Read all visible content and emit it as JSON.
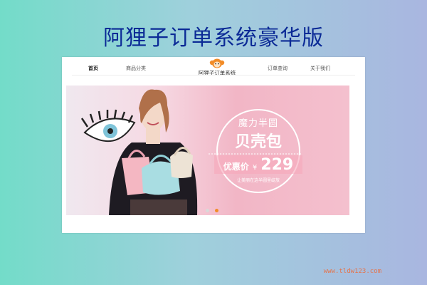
{
  "page_title": "阿狸子订单系统豪华版",
  "nav": {
    "items": [
      {
        "label": "首页",
        "active": true
      },
      {
        "label": "商品分类",
        "active": false
      },
      {
        "label": "订单查询",
        "active": false
      },
      {
        "label": "关于我们",
        "active": false
      }
    ],
    "brand_name": "阿狸子订单系统"
  },
  "banner": {
    "promo_sub": "魔力半圆",
    "promo_title": "贝壳包",
    "price_label": "优惠价",
    "currency": "¥",
    "price": "229",
    "note": "让美丽在这半圆里绽放",
    "slides": 2,
    "active_slide": 2
  },
  "footer_url": "www.tldw123.com",
  "colors": {
    "title": "#0b2a96",
    "accent": "#f28c28",
    "url": "#e5734a"
  }
}
